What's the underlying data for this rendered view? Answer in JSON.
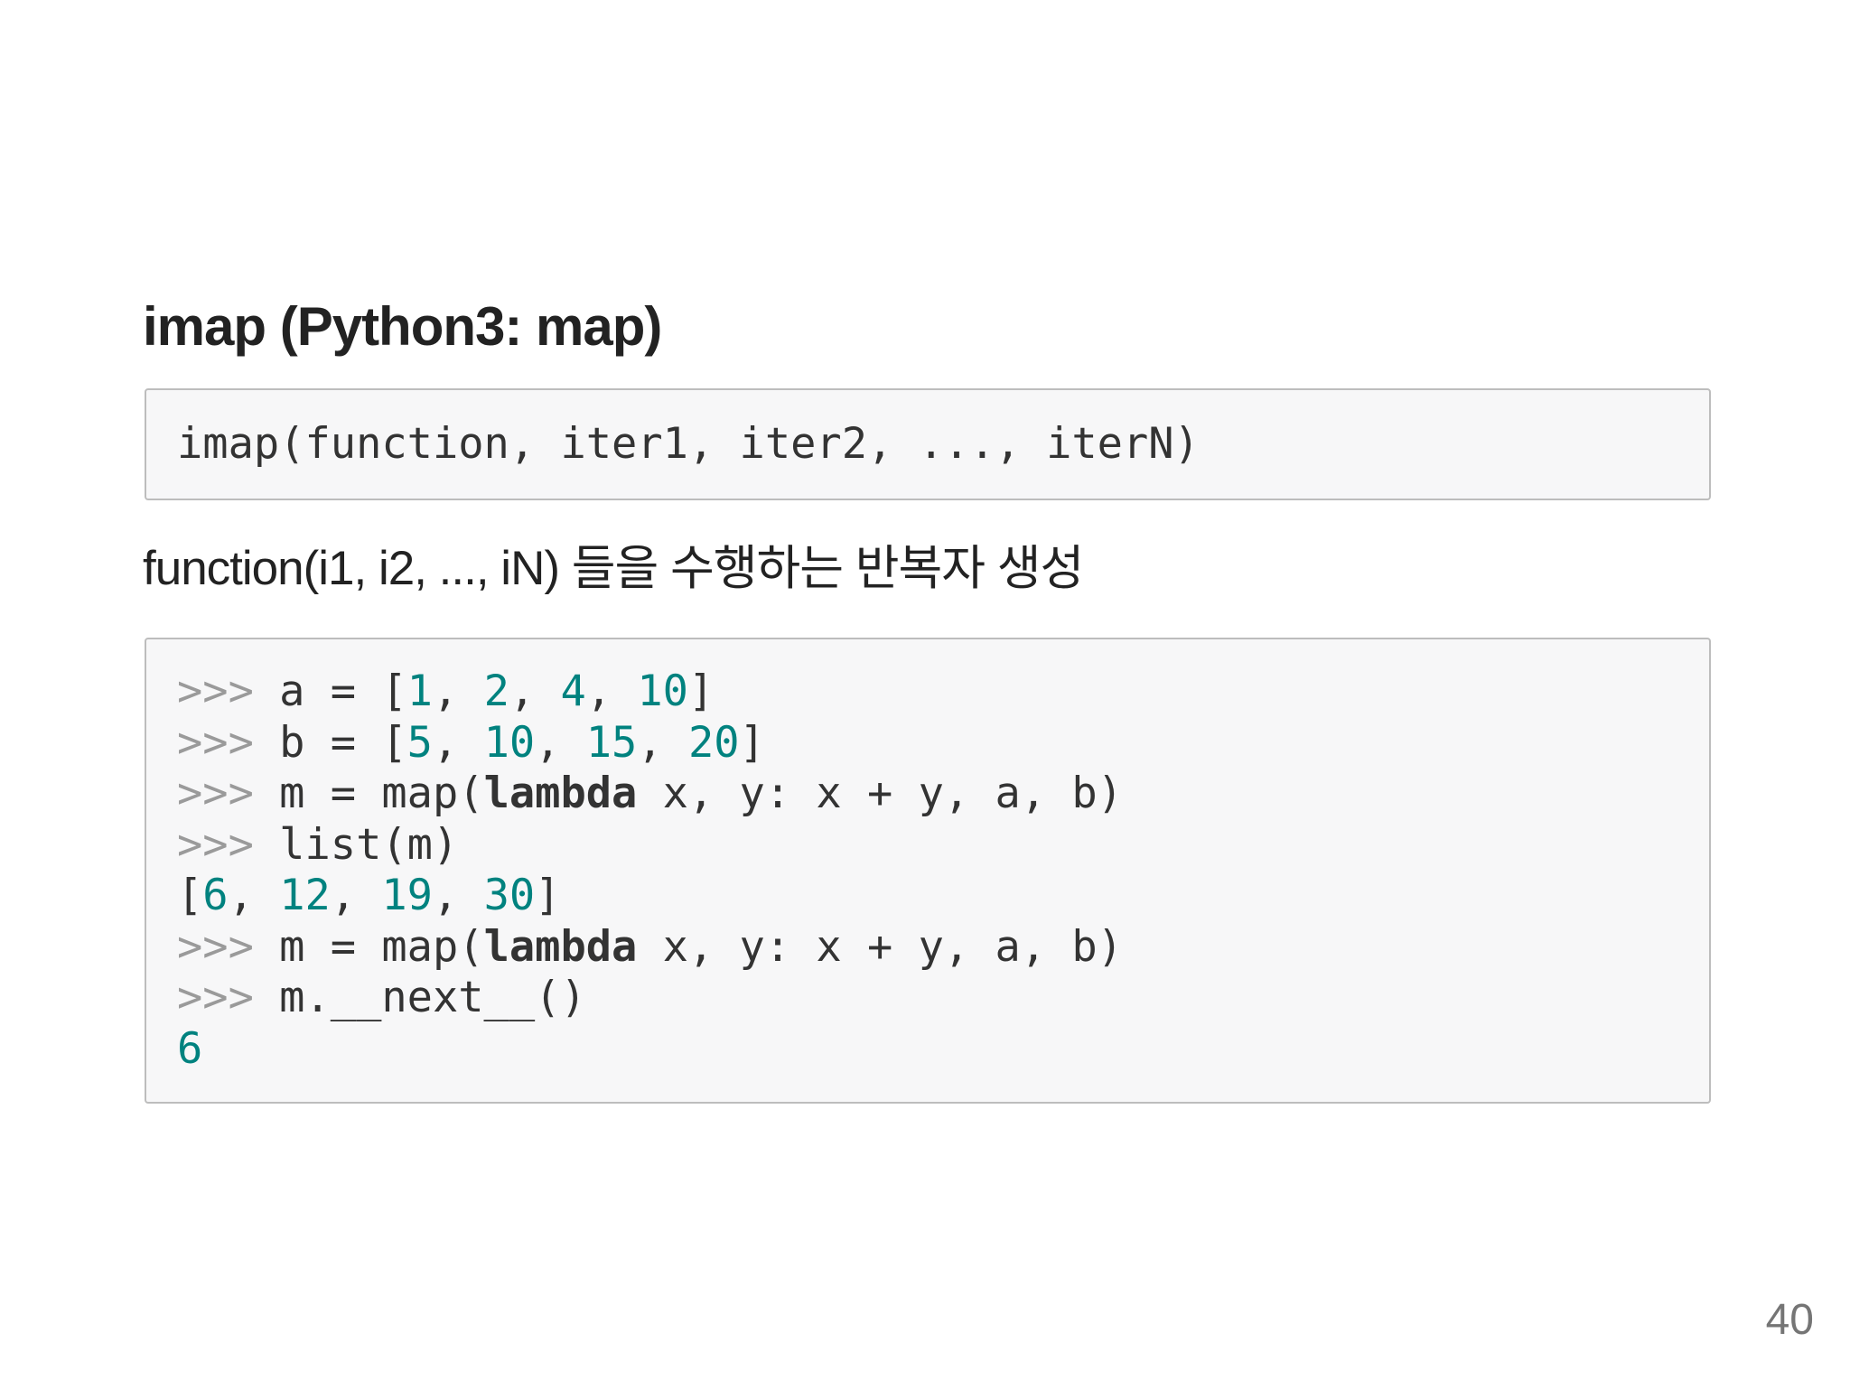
{
  "slide": {
    "title": "imap (Python3: map)",
    "signature": "imap(function, iter1, iter2, ..., iterN)",
    "description": "function(i1, i2, ..., iN) 들을 수행하는 반복자 생성",
    "page_number": "40"
  },
  "code_example": {
    "lines": [
      {
        "prompt": ">>>",
        "text": " a = [",
        "n1": "1",
        "s1": ", ",
        "n2": "2",
        "s2": ", ",
        "n3": "4",
        "s3": ", ",
        "n4": "10",
        "end": "]"
      },
      {
        "prompt": ">>>",
        "text": " b = [",
        "n1": "5",
        "s1": ", ",
        "n2": "10",
        "s2": ", ",
        "n3": "15",
        "s3": ", ",
        "n4": "20",
        "end": "]"
      },
      {
        "prompt": ">>>",
        "pre": " m = map(",
        "kw": "lambda",
        "post": " x, y: x + y, a, b)"
      },
      {
        "prompt": ">>>",
        "text": " list(m)"
      },
      {
        "open": "[",
        "n1": "6",
        "s1": ", ",
        "n2": "12",
        "s2": ", ",
        "n3": "19",
        "s3": ", ",
        "n4": "30",
        "end": "]"
      },
      {
        "prompt": ">>>",
        "pre": " m = map(",
        "kw": "lambda",
        "post": " x, y: x + y, a, b)"
      },
      {
        "prompt": ">>>",
        "text": " m.__next__()"
      },
      {
        "value": "6"
      }
    ]
  }
}
